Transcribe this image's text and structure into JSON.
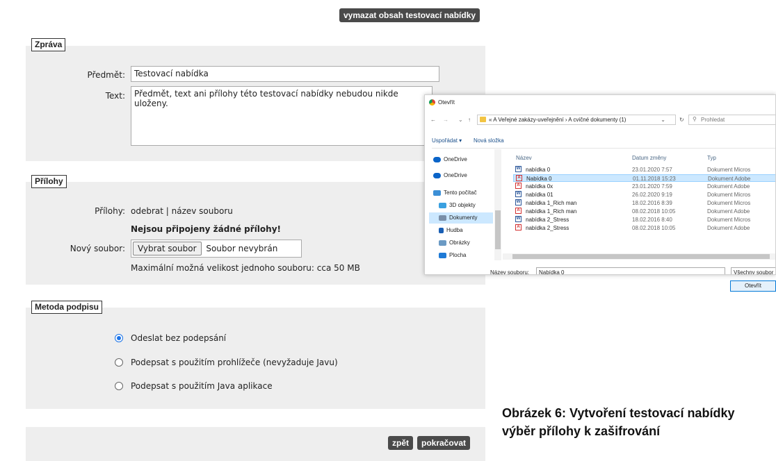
{
  "top": {
    "clear_button": "vymazat obsah testovací nabídky"
  },
  "zprava": {
    "legend": "Zpráva",
    "subject_label": "Předmět:",
    "subject_value": "Testovací nabídka",
    "text_label": "Text:",
    "text_value": "Předmět, text ani přílohy této testovací nabídky nebudou nikde uloženy."
  },
  "prilohy": {
    "legend": "Přílohy",
    "attachments_label": "Přílohy:",
    "attachments_header": "odebrat | název souboru",
    "none_attached": "Nejsou připojeny žádné přílohy!",
    "new_file_label": "Nový soubor:",
    "choose_file": "Vybrat soubor",
    "no_file": "Soubor nevybrán",
    "max_size": "Maximální možná velikost jednoho souboru: cca 50 MB"
  },
  "podpis": {
    "legend": "Metoda podpisu",
    "options": [
      {
        "label": "Odeslat bez podepsání",
        "selected": true
      },
      {
        "label": "Podepsat s použitím prohlížeče (nevyžaduje Javu)",
        "selected": false
      },
      {
        "label": "Podepsat s použitím Java aplikace",
        "selected": false
      }
    ]
  },
  "footer": {
    "back": "zpět",
    "continue": "pokračovat"
  },
  "dialog": {
    "title": "Otevřít",
    "breadcrumb": "« A Veřejné zakázy-uveřejnění › A cvičné dokumenty (1)",
    "search_placeholder": "Prohledat",
    "organize": "Uspořádat ▾",
    "new_folder": "Nová složka",
    "nav": [
      {
        "label": "OneDrive",
        "icon": "cloud-icon",
        "color": "#0a64c8"
      },
      {
        "label": "OneDrive",
        "icon": "cloud-icon",
        "color": "#0a64c8"
      },
      {
        "label": "Tento počítač",
        "icon": "computer-icon",
        "color": "#3c8fd6"
      },
      {
        "label": "3D objekty",
        "icon": "cube-icon",
        "color": "#3aa0e0"
      },
      {
        "label": "Dokumenty",
        "icon": "document-icon",
        "color": "#7a8fa8"
      },
      {
        "label": "Hudba",
        "icon": "music-icon",
        "color": "#1a5fb4"
      },
      {
        "label": "Obrázky",
        "icon": "image-icon",
        "color": "#6b9ac4"
      },
      {
        "label": "Plocha",
        "icon": "desktop-icon",
        "color": "#1e7ad6"
      }
    ],
    "columns": {
      "name": "Název",
      "date": "Datum změny",
      "type": "Typ"
    },
    "files": [
      {
        "name": "nabídka 0",
        "date": "23.01.2020 7:57",
        "type": "Dokument Micros",
        "kind": "word"
      },
      {
        "name": "Nabídka 0",
        "date": "01.11.2018 15:23",
        "type": "Dokument Adobe",
        "kind": "pdf",
        "selected": true
      },
      {
        "name": "nabídka 0x",
        "date": "23.01.2020 7:59",
        "type": "Dokument Adobe",
        "kind": "pdf"
      },
      {
        "name": "nabídka 01",
        "date": "26.02.2020 9:19",
        "type": "Dokument Micros",
        "kind": "word"
      },
      {
        "name": "nabídka 1_Rich man",
        "date": "18.02.2016 8:39",
        "type": "Dokument Micros",
        "kind": "word"
      },
      {
        "name": "nabídka 1_Rich man",
        "date": "08.02.2018 10:05",
        "type": "Dokument Adobe",
        "kind": "pdf"
      },
      {
        "name": "nabídka 2_Stress",
        "date": "18.02.2016 8:40",
        "type": "Dokument Micros",
        "kind": "word"
      },
      {
        "name": "nabídka 2_Stress",
        "date": "08.02.2018 10:05",
        "type": "Dokument Adobe",
        "kind": "pdf"
      }
    ],
    "filename_label": "Název souboru:",
    "filename_value": "Nabídka 0",
    "filter": "Všechny soubor",
    "open_button": "Otevřít"
  },
  "caption": {
    "line1": "Obrázek 6: Vytvoření testovací nabídky",
    "line2": "výběr přílohy k zašifrování"
  }
}
